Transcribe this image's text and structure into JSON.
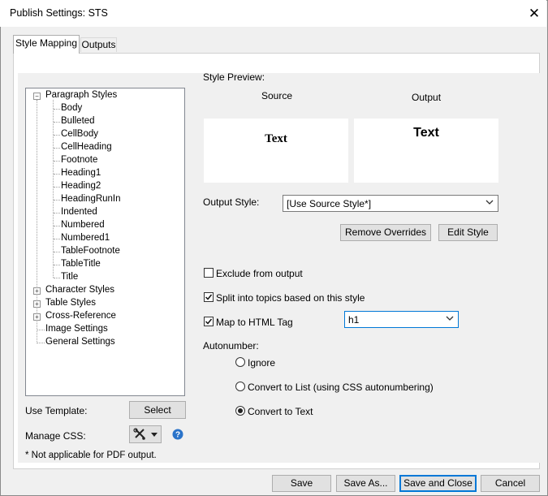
{
  "window": {
    "title": "Publish Settings: STS",
    "close_symbol": "✕"
  },
  "tabs": [
    {
      "label": "Style Mapping",
      "active": true
    },
    {
      "label": "Outputs",
      "active": false
    }
  ],
  "tree": {
    "paragraph_styles": {
      "label": "Paragraph Styles",
      "expanded": true,
      "children": [
        "Body",
        "Bulleted",
        "CellBody",
        "CellHeading",
        "Footnote",
        "Heading1",
        "Heading2",
        "HeadingRunIn",
        "Indented",
        "Numbered",
        "Numbered1",
        "TableFootnote",
        "TableTitle",
        "Title"
      ]
    },
    "character_styles": "Character Styles",
    "table_styles": "Table Styles",
    "cross_reference": "Cross-Reference",
    "image_settings": "Image Settings",
    "general_settings": "General Settings"
  },
  "preview": {
    "heading": "Style Preview:",
    "source_label": "Source",
    "output_label": "Output",
    "source_text": "Text",
    "output_text": "Text"
  },
  "output_style": {
    "label": "Output Style:",
    "value": "[Use Source Style*]"
  },
  "buttons": {
    "remove_overrides": "Remove Overrides",
    "edit_style": "Edit Style",
    "select": "Select",
    "save": "Save",
    "save_as": "Save As...",
    "save_and_close": "Save and Close",
    "cancel": "Cancel"
  },
  "options": {
    "exclude": {
      "label": "Exclude from output",
      "checked": false
    },
    "split": {
      "label": "Split into topics based on this style",
      "checked": true
    },
    "map_html": {
      "label": "Map to HTML Tag",
      "checked": true,
      "value": "h1"
    }
  },
  "autonumber": {
    "label": "Autonumber:",
    "options": [
      {
        "label": "Ignore",
        "selected": false
      },
      {
        "label": "Convert to List (using CSS autonumbering)",
        "selected": false
      },
      {
        "label": "Convert to Text",
        "selected": true
      }
    ]
  },
  "template": {
    "label": "Use Template:"
  },
  "css": {
    "label": "Manage CSS:"
  },
  "footnote": "* Not applicable for PDF output.",
  "colors": {
    "accent": "#0078d7",
    "help": "#2a73c9"
  }
}
